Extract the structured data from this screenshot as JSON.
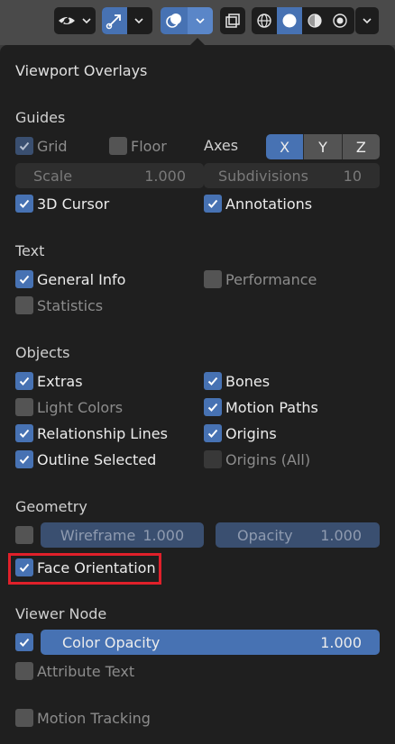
{
  "colors": {
    "accent": "#4772b3",
    "popup_bg": "#1f1f1f",
    "highlight": "#e0202a"
  },
  "toolbar": {
    "icons": [
      "eye-icon",
      "gizmo-icon",
      "overlays-icon",
      "xray-icon",
      "wireframe-shading-icon",
      "solid-shading-icon",
      "material-shading-icon",
      "rendered-shading-icon"
    ]
  },
  "popup": {
    "title": "Viewport Overlays"
  },
  "guides": {
    "heading": "Guides",
    "grid": {
      "label": "Grid",
      "checked": true
    },
    "floor": {
      "label": "Floor",
      "checked": false
    },
    "axes_label": "Axes",
    "axes": [
      {
        "label": "X",
        "active": true
      },
      {
        "label": "Y",
        "active": false
      },
      {
        "label": "Z",
        "active": false
      }
    ],
    "scale": {
      "label": "Scale",
      "value": "1.000"
    },
    "subdivisions": {
      "label": "Subdivisions",
      "value": "10"
    },
    "cursor": {
      "label": "3D Cursor",
      "checked": true
    },
    "annotations": {
      "label": "Annotations",
      "checked": true
    }
  },
  "text": {
    "heading": "Text",
    "general_info": {
      "label": "General Info",
      "checked": true
    },
    "performance": {
      "label": "Performance",
      "checked": false
    },
    "statistics": {
      "label": "Statistics",
      "checked": false
    }
  },
  "objects": {
    "heading": "Objects",
    "extras": {
      "label": "Extras",
      "checked": true
    },
    "bones": {
      "label": "Bones",
      "checked": true
    },
    "light_colors": {
      "label": "Light Colors",
      "checked": false
    },
    "motion_paths": {
      "label": "Motion Paths",
      "checked": true
    },
    "relationship_lines": {
      "label": "Relationship Lines",
      "checked": true
    },
    "origins": {
      "label": "Origins",
      "checked": true
    },
    "outline_selected": {
      "label": "Outline Selected",
      "checked": true
    },
    "origins_all": {
      "label": "Origins (All)",
      "checked": false
    }
  },
  "geometry": {
    "heading": "Geometry",
    "wireframe": {
      "label": "Wireframe",
      "value": "1.000",
      "checked": false
    },
    "opacity": {
      "label": "Opacity",
      "value": "1.000"
    },
    "face_orientation": {
      "label": "Face Orientation",
      "checked": true
    }
  },
  "viewer_node": {
    "heading": "Viewer Node",
    "color_opacity": {
      "label": "Color Opacity",
      "value": "1.000",
      "checked": true
    },
    "attribute_text": {
      "label": "Attribute Text",
      "checked": false
    }
  },
  "motion_tracking": {
    "label": "Motion Tracking",
    "checked": false
  }
}
